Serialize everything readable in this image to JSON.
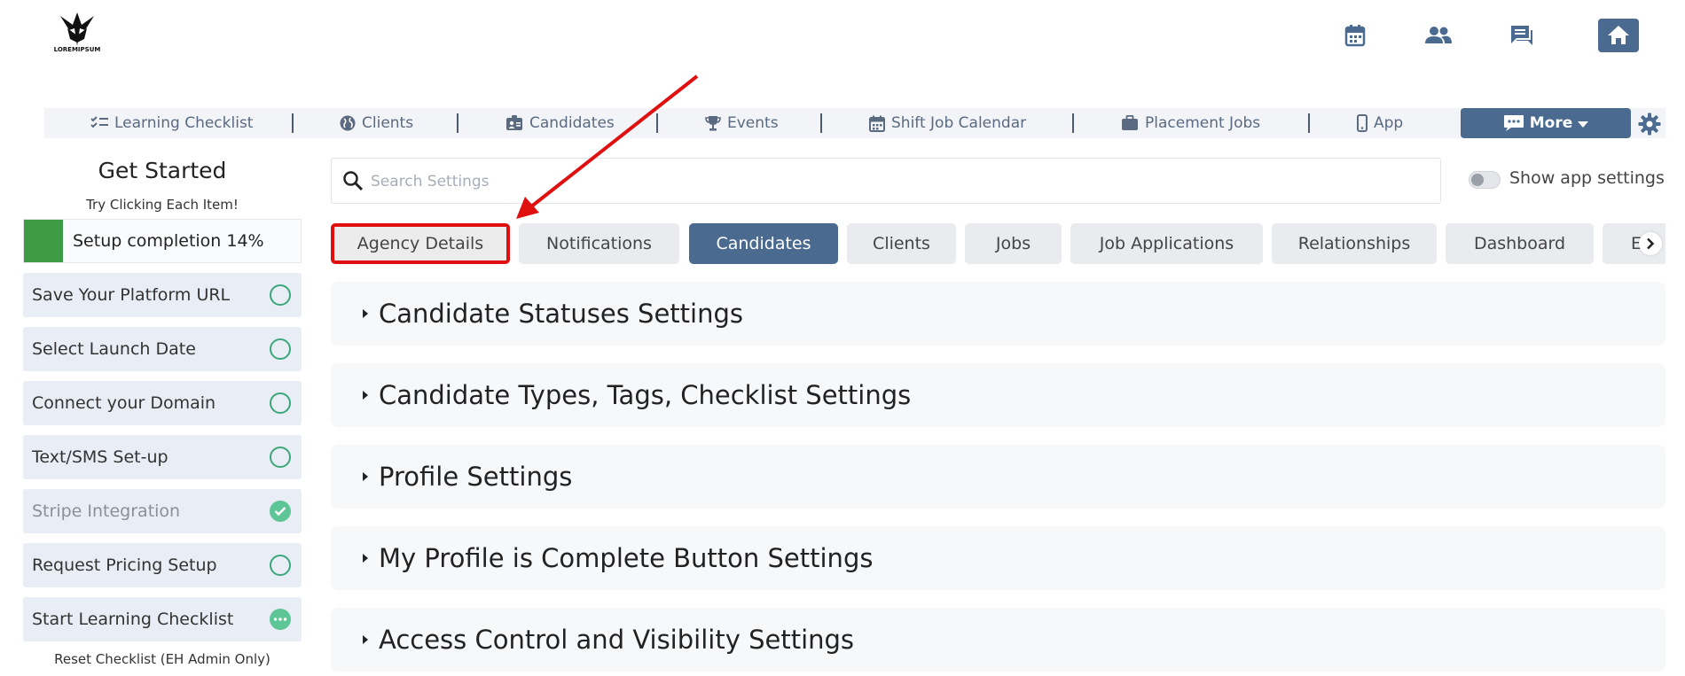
{
  "logo": {
    "text": "LOREMIPSUM"
  },
  "header_icons": [
    "calendar-icon",
    "people-icon",
    "chat-icon",
    "home-icon"
  ],
  "top_nav": {
    "items": [
      {
        "label": "Learning Checklist",
        "icon": "checklist-icon"
      },
      {
        "label": "Clients",
        "icon": "globe-icon"
      },
      {
        "label": "Candidates",
        "icon": "id-badge-icon"
      },
      {
        "label": "Events",
        "icon": "trophy-icon"
      },
      {
        "label": "Shift Job Calendar",
        "icon": "calendar-icon"
      },
      {
        "label": "Placement Jobs",
        "icon": "briefcase-icon"
      },
      {
        "label": "App",
        "icon": "mobile-icon"
      }
    ],
    "more_label": "More"
  },
  "sidebar": {
    "title": "Get Started",
    "subtitle": "Try Clicking Each Item!",
    "progress": {
      "label": "Setup completion 14%",
      "percent": 14
    },
    "items": [
      {
        "label": "Save Your Platform URL",
        "status": "open"
      },
      {
        "label": "Select Launch Date",
        "status": "open"
      },
      {
        "label": "Connect your Domain",
        "status": "open"
      },
      {
        "label": "Text/SMS Set-up",
        "status": "open"
      },
      {
        "label": "Stripe Integration",
        "status": "done"
      },
      {
        "label": "Request Pricing Setup",
        "status": "open"
      },
      {
        "label": "Start Learning Checklist",
        "status": "in-progress"
      }
    ],
    "reset_label": "Reset Checklist (EH Admin Only)"
  },
  "search": {
    "placeholder": "Search Settings",
    "value": ""
  },
  "toggle": {
    "label": "Show app settings",
    "on": false
  },
  "tabs": [
    {
      "label": "Agency Details",
      "state": "highlighted"
    },
    {
      "label": "Notifications",
      "state": "normal"
    },
    {
      "label": "Candidates",
      "state": "active"
    },
    {
      "label": "Clients",
      "state": "normal"
    },
    {
      "label": "Jobs",
      "state": "normal"
    },
    {
      "label": "Job Applications",
      "state": "normal"
    },
    {
      "label": "Relationships",
      "state": "normal"
    },
    {
      "label": "Dashboard",
      "state": "normal"
    },
    {
      "label": "E",
      "state": "normal"
    }
  ],
  "sections": [
    "Candidate Statuses Settings",
    "Candidate Types, Tags, Checklist Settings",
    "Profile Settings",
    "My Profile is Complete Button Settings",
    "Access Control and Visibility Settings"
  ],
  "colors": {
    "accent": "#4a6a8f",
    "progress": "#3f9a45",
    "status_green": "#3aa879",
    "annotation_red": "#e01010"
  }
}
